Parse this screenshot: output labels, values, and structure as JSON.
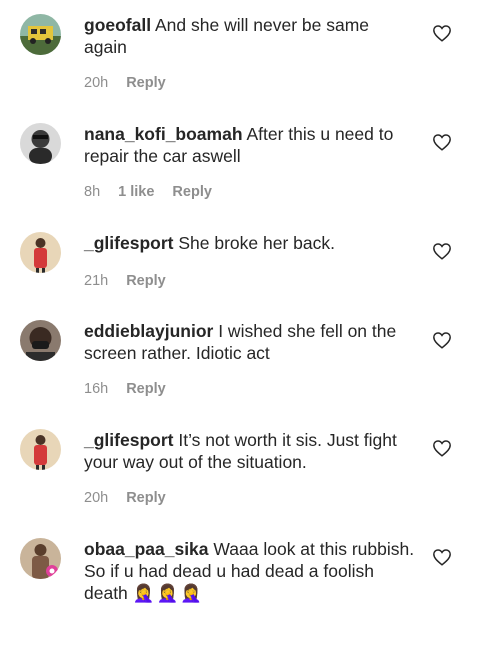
{
  "comments": [
    {
      "username": "goeofall",
      "text": "And she will never be same again",
      "time": "20h",
      "likes": "",
      "reply_label": "Reply",
      "avatar_color": "#c9a93a"
    },
    {
      "username": "nana_kofi_boamah",
      "text": "After this u need to repair the car aswell",
      "time": "8h",
      "likes": "1 like",
      "reply_label": "Reply",
      "avatar_color": "#6f6f6f"
    },
    {
      "username": "_glifesport",
      "text": "She broke her back.",
      "time": "21h",
      "likes": "",
      "reply_label": "Reply",
      "avatar_color": "#d43a3a"
    },
    {
      "username": "eddieblayjunior",
      "text": "I wished she fell on the screen rather. Idiotic act",
      "time": "16h",
      "likes": "",
      "reply_label": "Reply",
      "avatar_color": "#3a2a22"
    },
    {
      "username": "_glifesport",
      "text": "It’s not worth it sis. Just fight your way out of the situation.",
      "time": "20h",
      "likes": "",
      "reply_label": "Reply",
      "avatar_color": "#d43a3a"
    },
    {
      "username": "obaa_paa_sika",
      "text": "Waaa look at this rubbish. So if u had dead u had dead a foolish death",
      "emoji": "🤦‍♀️🤦‍♀️🤦‍♀️",
      "time": "",
      "likes": "",
      "reply_label": "",
      "avatar_color": "#b08a6a"
    }
  ],
  "icons": {
    "like": "heart-outline-icon"
  }
}
